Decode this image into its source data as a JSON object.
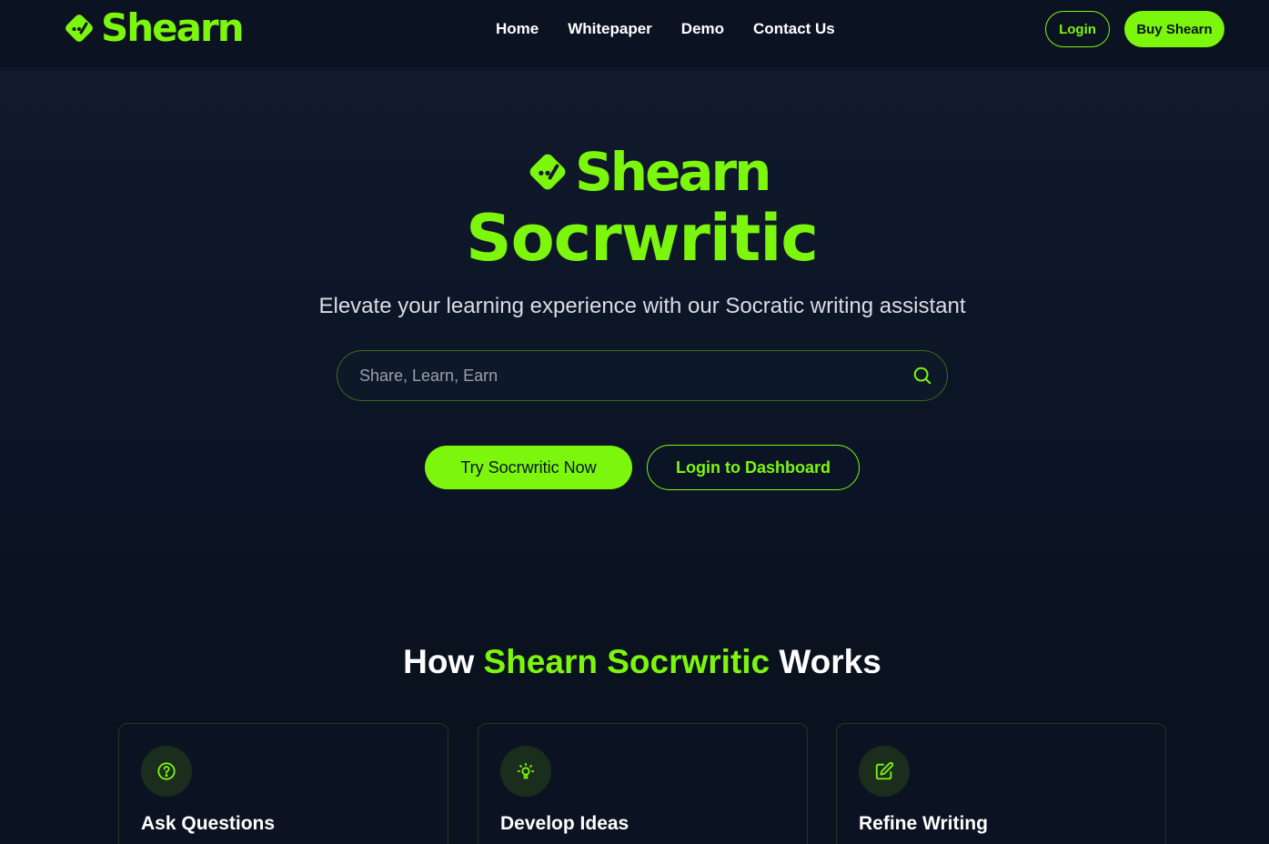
{
  "header": {
    "logo_text": "Shearn",
    "nav": [
      {
        "label": "Home"
      },
      {
        "label": "Whitepaper"
      },
      {
        "label": "Demo"
      },
      {
        "label": "Contact Us"
      }
    ],
    "login_label": "Login",
    "buy_label": "Buy Shearn"
  },
  "hero": {
    "logo_text": "Shearn",
    "title": "Socrwritic",
    "subtitle": "Elevate your learning experience with our Socratic writing assistant",
    "search": {
      "placeholder": "Share, Learn, Earn",
      "icon": "search-icon"
    },
    "primary_button": "Try Socrwritic Now",
    "secondary_button": "Login to Dashboard"
  },
  "how": {
    "title_prefix": "How ",
    "title_accent": "Shearn Socrwritic",
    "title_suffix": " Works",
    "cards": [
      {
        "title": "Ask Questions",
        "icon": "question-icon"
      },
      {
        "title": "Develop Ideas",
        "icon": "lightbulb-icon"
      },
      {
        "title": "Refine Writing",
        "icon": "edit-icon"
      }
    ]
  },
  "colors": {
    "accent": "#7cf60d",
    "background": "#0a1220"
  }
}
